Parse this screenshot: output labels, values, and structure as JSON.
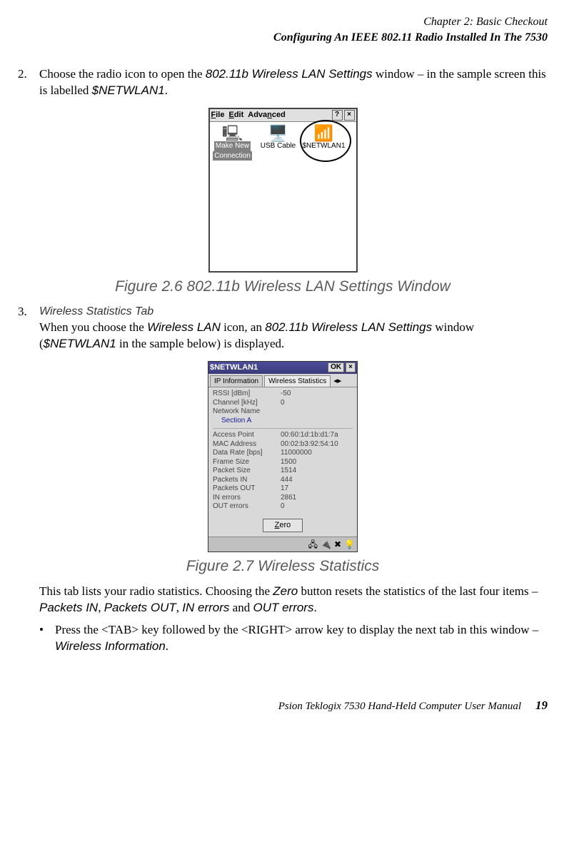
{
  "header": {
    "line1": "Chapter 2: Basic Checkout",
    "line2": "Configuring An IEEE 802.11 Radio Installed In The 7530"
  },
  "step2": {
    "num": "2.",
    "pre": "Choose the radio icon to open the ",
    "settings": "802.11b Wireless LAN Settings",
    "mid": " window – in the sample screen this is labelled ",
    "net": "$NETWLAN1",
    "end": "."
  },
  "fig26": {
    "menu": {
      "file": "File",
      "edit": "Edit",
      "adv": "Advanced",
      "help": "?",
      "close": "×"
    },
    "icons": {
      "makenew1": "Make New",
      "makenew2": "Connection",
      "usb": "USB Cable",
      "netwlan": "$NETWLAN1"
    },
    "caption": "Figure 2.6 802.11b Wireless LAN Settings Window"
  },
  "step3": {
    "num": "3.",
    "heading": "Wireless Statistics Tab",
    "pre": "When you choose the ",
    "wlan": "Wireless LAN",
    "mid": " icon, an ",
    "settings": "802.11b Wireless LAN Settings",
    "mid2": " window (",
    "net": "$NETWLAN1",
    "end": " in the sample below) is displayed."
  },
  "fig27": {
    "title": "$NETWLAN1",
    "ok": "OK",
    "close": "×",
    "tab_ip": "IP Information",
    "tab_ws": "Wireless Statistics",
    "arrows_left": "◂",
    "arrows_right": "▸",
    "rows1": [
      {
        "k": "RSSI [dBm]",
        "v": "-50"
      },
      {
        "k": "Channel [kHz]",
        "v": "0"
      }
    ],
    "netname_k": "Network Name",
    "section": "Section A",
    "rows2": [
      {
        "k": "Access Point",
        "v": "00:60:1d:1b:d1:7a"
      },
      {
        "k": "MAC Address",
        "v": "00:02:b3:92:54:10"
      },
      {
        "k": "Data Rate [bps]",
        "v": "11000000"
      },
      {
        "k": "Frame Size",
        "v": "1500"
      },
      {
        "k": "Packet Size",
        "v": "1514"
      },
      {
        "k": "Packets IN",
        "v": "444"
      },
      {
        "k": "Packets OUT",
        "v": "17"
      },
      {
        "k": "IN errors",
        "v": "2861"
      },
      {
        "k": "OUT errors",
        "v": "0"
      }
    ],
    "zero_u": "Z",
    "zero_rest": "ero",
    "caption": "Figure 2.7 Wireless Statistics"
  },
  "post": {
    "pre": "This tab lists your radio statistics. Choosing the ",
    "zero": "Zero",
    "mid": " button resets the statistics of the last four items – ",
    "pin": "Packets IN",
    "c1": ", ",
    "pout": "Packets OUT",
    "c2": ", ",
    "inerr": "IN errors",
    "and": " and ",
    "outerr": "OUT errors",
    "end": "."
  },
  "bullet": {
    "dot": "•",
    "pre": "Press the <TAB> key followed by the <RIGHT> arrow key to display the next tab in this window – ",
    "wi": "Wireless Information",
    "end": "."
  },
  "footer": {
    "text": "Psion Teklogix 7530 Hand-Held Computer User Manual",
    "page": "19"
  }
}
